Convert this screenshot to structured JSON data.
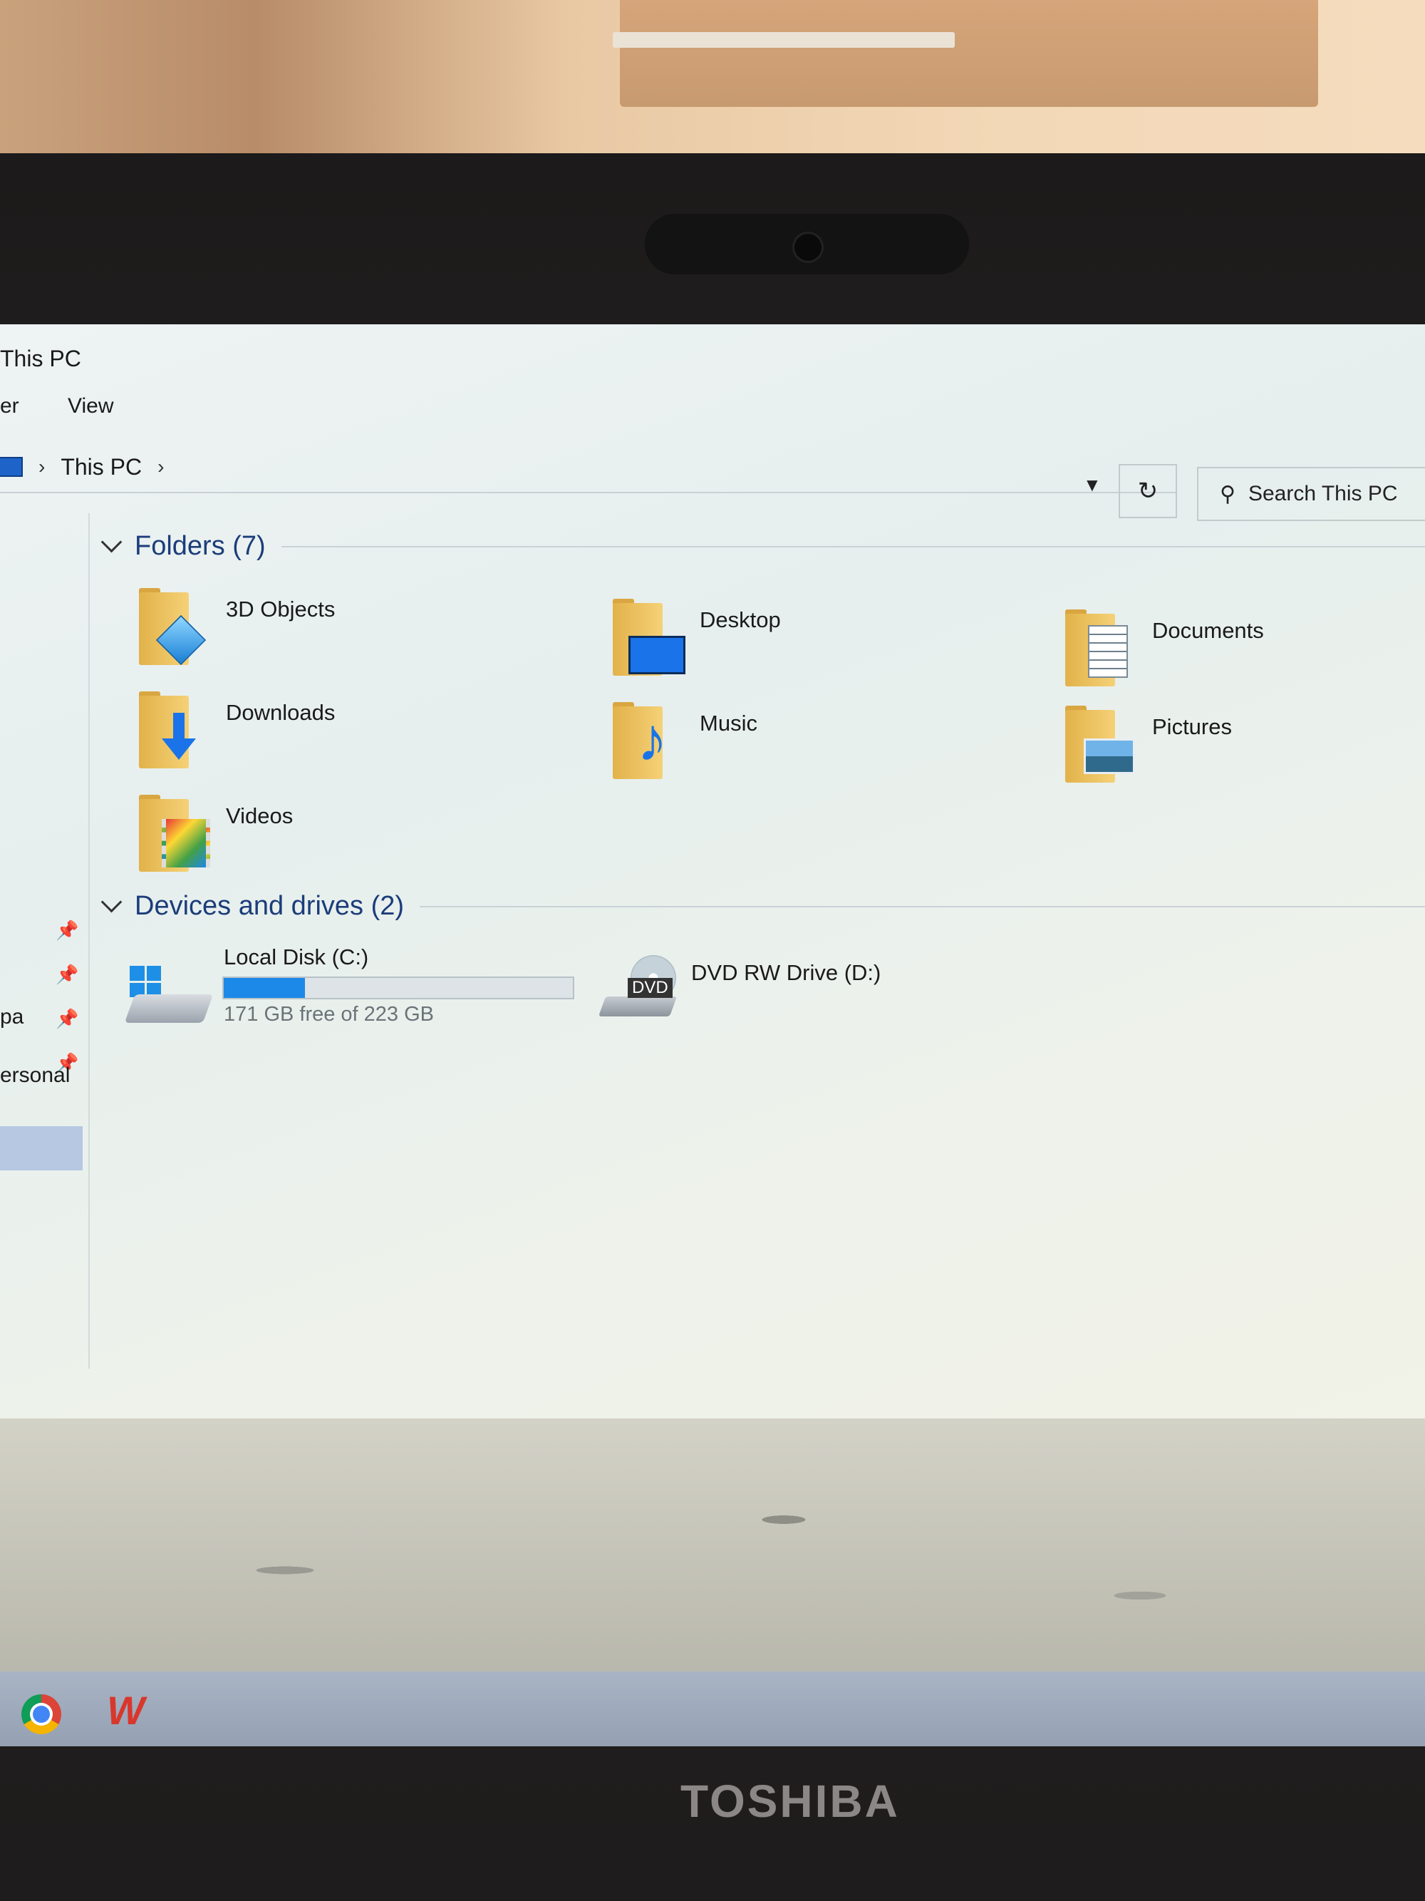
{
  "window": {
    "title": "This PC",
    "menu": [
      "er",
      "View"
    ]
  },
  "address": {
    "path": [
      "This PC"
    ],
    "search_placeholder": "Search This PC"
  },
  "nav": {
    "items": [
      "pa",
      "ersonal"
    ]
  },
  "folders": {
    "header": "Folders (7)",
    "items": [
      {
        "label": "3D Objects",
        "icon": "3d-objects-folder-icon"
      },
      {
        "label": "Desktop",
        "icon": "desktop-folder-icon"
      },
      {
        "label": "Documents",
        "icon": "documents-folder-icon"
      },
      {
        "label": "Downloads",
        "icon": "downloads-folder-icon"
      },
      {
        "label": "Music",
        "icon": "music-folder-icon"
      },
      {
        "label": "Pictures",
        "icon": "pictures-folder-icon"
      },
      {
        "label": "Videos",
        "icon": "videos-folder-icon"
      }
    ]
  },
  "drives": {
    "header": "Devices and drives (2)",
    "items": [
      {
        "label": "Local Disk (C:)",
        "free_text": "171 GB free of 223 GB",
        "used_fraction": 0.233,
        "icon": "local-disk-icon"
      },
      {
        "label": "DVD RW Drive (D:)",
        "badge": "DVD",
        "icon": "dvd-drive-icon"
      }
    ]
  },
  "taskbar": {
    "icons": [
      "chrome-icon",
      "wps-office-icon"
    ]
  },
  "laptop": {
    "brand": "TOSHIBA"
  },
  "colors": {
    "accent": "#1c89e8",
    "header_text": "#1c3d7a",
    "folder": "#e2b24a"
  }
}
